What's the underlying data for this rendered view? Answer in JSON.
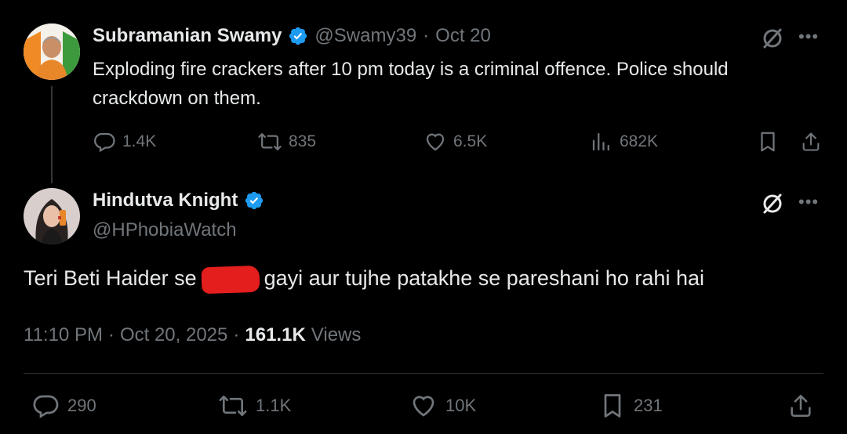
{
  "quoted": {
    "name": "Subramanian Swamy",
    "handle": "@Swamy39",
    "sep": "·",
    "date": "Oct 20",
    "text": "Exploding fire crackers after 10 pm today is a criminal offence. Police should crackdown on them.",
    "replies": "1.4K",
    "reposts": "835",
    "likes": "6.5K",
    "views": "682K"
  },
  "main": {
    "name": "Hindutva Knight",
    "handle": "@HPhobiaWatch",
    "text_before": "Teri Beti Haider se",
    "text_after": "gayi aur tujhe patakhe se pareshani ho rahi hai",
    "time": "11:10 PM",
    "sep": "·",
    "date": "Oct 20, 2025",
    "sep2": "·",
    "views_count": "161.1K",
    "views_label": "Views",
    "replies": "290",
    "reposts": "1.1K",
    "likes": "10K",
    "bookmarks": "231"
  },
  "colors": {
    "background": "#000000",
    "text": "#e7e9ea",
    "muted": "#71767b",
    "verified": "#1d9bf0",
    "redaction": "#e41d1d"
  }
}
